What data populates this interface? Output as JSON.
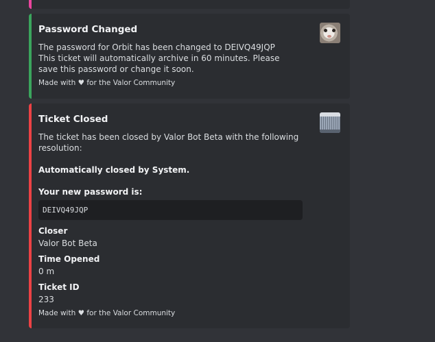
{
  "password_embed": {
    "title": "Password Changed",
    "desc_line1": "The password for Orbit has been changed to DEIVQ49JQP",
    "desc_line2": "This ticket will automatically archive in 60 minutes. Please save this password or change it soon.",
    "footer_prefix": "Made with",
    "footer_heart": "♥",
    "footer_suffix": "for the Valor Community",
    "accent": "#3ba55d",
    "thumbnail_icon": "cat-avatar"
  },
  "ticket_embed": {
    "title": "Ticket Closed",
    "desc": "The ticket has been closed by Valor Bot Beta with the following resolution:",
    "resolution": "Automatically closed by System.",
    "password_label": "Your new password is:",
    "password_value": "DEIVQ49JQP",
    "fields": [
      {
        "name": "Closer",
        "value": "Valor Bot Beta"
      },
      {
        "name": "Time Opened",
        "value": "0 m"
      },
      {
        "name": "Ticket ID",
        "value": "233"
      }
    ],
    "footer_prefix": "Made with",
    "footer_heart": "♥",
    "footer_suffix": "for the Valor Community",
    "accent": "#ed4245",
    "thumbnail_icon": "grid-thumbnail"
  },
  "top_stub_accent": "#eb459e"
}
